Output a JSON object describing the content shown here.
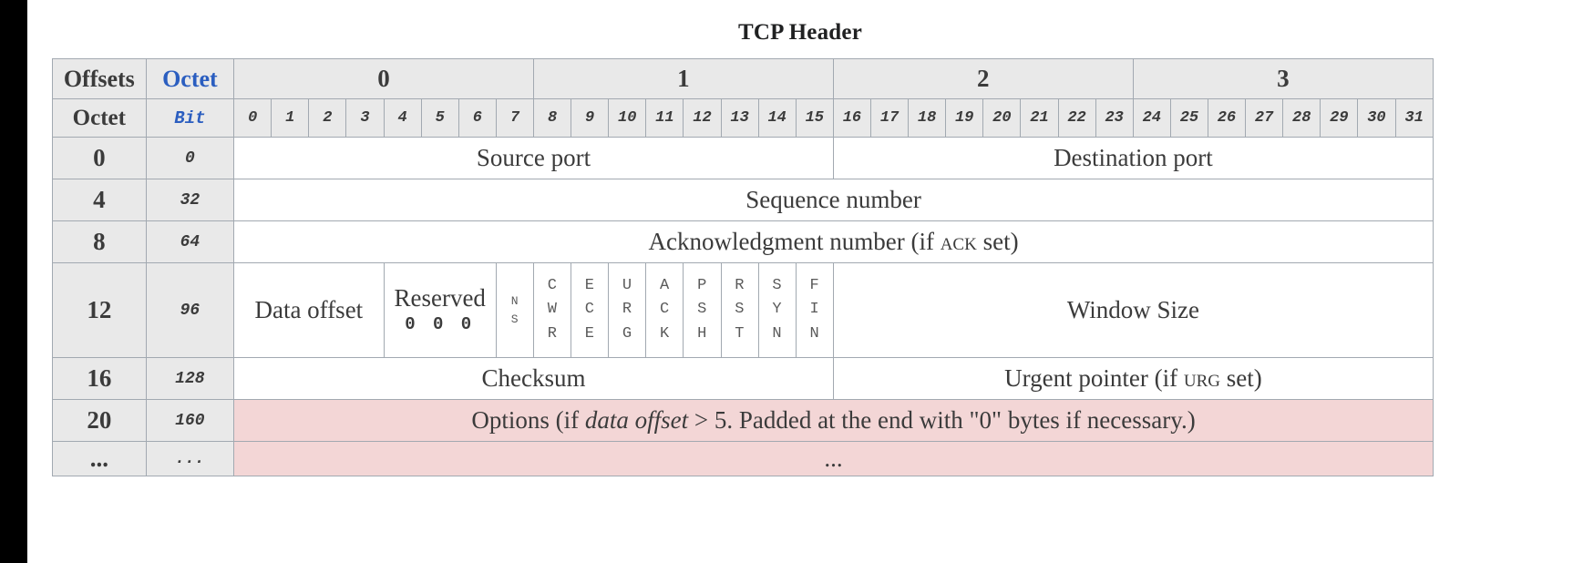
{
  "title": "TCP Header",
  "header": {
    "offsets_label": "Offsets",
    "octet_label_top": "Octet",
    "octet_label_left": "Octet",
    "bit_label": "Bit",
    "octet_groups": [
      "0",
      "1",
      "2",
      "3"
    ],
    "bits": [
      "0",
      "1",
      "2",
      "3",
      "4",
      "5",
      "6",
      "7",
      "8",
      "9",
      "10",
      "11",
      "12",
      "13",
      "14",
      "15",
      "16",
      "17",
      "18",
      "19",
      "20",
      "21",
      "22",
      "23",
      "24",
      "25",
      "26",
      "27",
      "28",
      "29",
      "30",
      "31"
    ]
  },
  "rows": [
    {
      "octet": "0",
      "bit": "0",
      "fields": [
        {
          "label": "Source port",
          "bits": 16
        },
        {
          "label": "Destination port",
          "bits": 16
        }
      ]
    },
    {
      "octet": "4",
      "bit": "32",
      "fields": [
        {
          "label": "Sequence number",
          "bits": 32
        }
      ]
    },
    {
      "octet": "8",
      "bit": "64",
      "fields": [
        {
          "label": "Acknowledgment number (if ACK set)",
          "label_main": "Acknowledgment number (if ",
          "label_sc": "ACK",
          "label_tail": " set)",
          "bits": 32
        }
      ]
    },
    {
      "octet": "12",
      "bit": "96",
      "flags_row": true,
      "fields": [
        {
          "label": "Data offset",
          "bits": 4
        },
        {
          "label": "Reserved",
          "zeros": "0 0 0",
          "bits": 3
        },
        {
          "label": "NS",
          "letters": [
            "N",
            "S"
          ],
          "bits": 1,
          "small": true
        },
        {
          "label": "CWR",
          "letters": [
            "C",
            "W",
            "R"
          ],
          "bits": 1
        },
        {
          "label": "ECE",
          "letters": [
            "E",
            "C",
            "E"
          ],
          "bits": 1
        },
        {
          "label": "URG",
          "letters": [
            "U",
            "R",
            "G"
          ],
          "bits": 1
        },
        {
          "label": "ACK",
          "letters": [
            "A",
            "C",
            "K"
          ],
          "bits": 1
        },
        {
          "label": "PSH",
          "letters": [
            "P",
            "S",
            "H"
          ],
          "bits": 1
        },
        {
          "label": "RST",
          "letters": [
            "R",
            "S",
            "T"
          ],
          "bits": 1
        },
        {
          "label": "SYN",
          "letters": [
            "S",
            "Y",
            "N"
          ],
          "bits": 1
        },
        {
          "label": "FIN",
          "letters": [
            "F",
            "I",
            "N"
          ],
          "bits": 1
        },
        {
          "label": "Window Size",
          "bits": 16
        }
      ]
    },
    {
      "octet": "16",
      "bit": "128",
      "fields": [
        {
          "label": "Checksum",
          "bits": 16
        },
        {
          "label": "Urgent pointer (if URG set)",
          "label_main": "Urgent pointer (if ",
          "label_sc": "URG",
          "label_tail": " set)",
          "bits": 16
        }
      ]
    },
    {
      "octet": "20",
      "bit": "160",
      "options": true,
      "fields": [
        {
          "label": "Options (if data offset > 5. Padded at the end with \"0\" bytes if necessary.)",
          "part1": "Options (if ",
          "part_italic": "data offset",
          "part2": " > 5. Padded at the end with \"0\" bytes if necessary.)",
          "bits": 32
        }
      ]
    },
    {
      "octet": "...",
      "bit": "...",
      "options": true,
      "dots": true,
      "fields": [
        {
          "label": "...",
          "bits": 32
        }
      ]
    }
  ],
  "colors": {
    "header_grey": "#e9e9e9",
    "options_pink": "#f3d6d6",
    "border": "#a2a9b1",
    "text": "#3b3b3b",
    "blue_label": "#2b5ec0",
    "page_background": "#000000"
  }
}
